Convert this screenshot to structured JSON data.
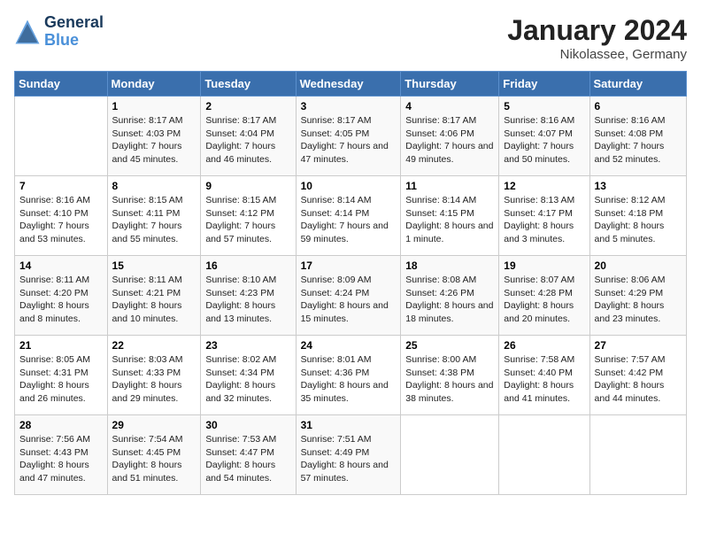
{
  "header": {
    "logo_line1": "General",
    "logo_line2": "Blue",
    "month_title": "January 2024",
    "location": "Nikolassee, Germany"
  },
  "weekdays": [
    "Sunday",
    "Monday",
    "Tuesday",
    "Wednesday",
    "Thursday",
    "Friday",
    "Saturday"
  ],
  "weeks": [
    [
      {
        "day": "",
        "sunrise": "",
        "sunset": "",
        "daylight": ""
      },
      {
        "day": "1",
        "sunrise": "Sunrise: 8:17 AM",
        "sunset": "Sunset: 4:03 PM",
        "daylight": "Daylight: 7 hours and 45 minutes."
      },
      {
        "day": "2",
        "sunrise": "Sunrise: 8:17 AM",
        "sunset": "Sunset: 4:04 PM",
        "daylight": "Daylight: 7 hours and 46 minutes."
      },
      {
        "day": "3",
        "sunrise": "Sunrise: 8:17 AM",
        "sunset": "Sunset: 4:05 PM",
        "daylight": "Daylight: 7 hours and 47 minutes."
      },
      {
        "day": "4",
        "sunrise": "Sunrise: 8:17 AM",
        "sunset": "Sunset: 4:06 PM",
        "daylight": "Daylight: 7 hours and 49 minutes."
      },
      {
        "day": "5",
        "sunrise": "Sunrise: 8:16 AM",
        "sunset": "Sunset: 4:07 PM",
        "daylight": "Daylight: 7 hours and 50 minutes."
      },
      {
        "day": "6",
        "sunrise": "Sunrise: 8:16 AM",
        "sunset": "Sunset: 4:08 PM",
        "daylight": "Daylight: 7 hours and 52 minutes."
      }
    ],
    [
      {
        "day": "7",
        "sunrise": "Sunrise: 8:16 AM",
        "sunset": "Sunset: 4:10 PM",
        "daylight": "Daylight: 7 hours and 53 minutes."
      },
      {
        "day": "8",
        "sunrise": "Sunrise: 8:15 AM",
        "sunset": "Sunset: 4:11 PM",
        "daylight": "Daylight: 7 hours and 55 minutes."
      },
      {
        "day": "9",
        "sunrise": "Sunrise: 8:15 AM",
        "sunset": "Sunset: 4:12 PM",
        "daylight": "Daylight: 7 hours and 57 minutes."
      },
      {
        "day": "10",
        "sunrise": "Sunrise: 8:14 AM",
        "sunset": "Sunset: 4:14 PM",
        "daylight": "Daylight: 7 hours and 59 minutes."
      },
      {
        "day": "11",
        "sunrise": "Sunrise: 8:14 AM",
        "sunset": "Sunset: 4:15 PM",
        "daylight": "Daylight: 8 hours and 1 minute."
      },
      {
        "day": "12",
        "sunrise": "Sunrise: 8:13 AM",
        "sunset": "Sunset: 4:17 PM",
        "daylight": "Daylight: 8 hours and 3 minutes."
      },
      {
        "day": "13",
        "sunrise": "Sunrise: 8:12 AM",
        "sunset": "Sunset: 4:18 PM",
        "daylight": "Daylight: 8 hours and 5 minutes."
      }
    ],
    [
      {
        "day": "14",
        "sunrise": "Sunrise: 8:11 AM",
        "sunset": "Sunset: 4:20 PM",
        "daylight": "Daylight: 8 hours and 8 minutes."
      },
      {
        "day": "15",
        "sunrise": "Sunrise: 8:11 AM",
        "sunset": "Sunset: 4:21 PM",
        "daylight": "Daylight: 8 hours and 10 minutes."
      },
      {
        "day": "16",
        "sunrise": "Sunrise: 8:10 AM",
        "sunset": "Sunset: 4:23 PM",
        "daylight": "Daylight: 8 hours and 13 minutes."
      },
      {
        "day": "17",
        "sunrise": "Sunrise: 8:09 AM",
        "sunset": "Sunset: 4:24 PM",
        "daylight": "Daylight: 8 hours and 15 minutes."
      },
      {
        "day": "18",
        "sunrise": "Sunrise: 8:08 AM",
        "sunset": "Sunset: 4:26 PM",
        "daylight": "Daylight: 8 hours and 18 minutes."
      },
      {
        "day": "19",
        "sunrise": "Sunrise: 8:07 AM",
        "sunset": "Sunset: 4:28 PM",
        "daylight": "Daylight: 8 hours and 20 minutes."
      },
      {
        "day": "20",
        "sunrise": "Sunrise: 8:06 AM",
        "sunset": "Sunset: 4:29 PM",
        "daylight": "Daylight: 8 hours and 23 minutes."
      }
    ],
    [
      {
        "day": "21",
        "sunrise": "Sunrise: 8:05 AM",
        "sunset": "Sunset: 4:31 PM",
        "daylight": "Daylight: 8 hours and 26 minutes."
      },
      {
        "day": "22",
        "sunrise": "Sunrise: 8:03 AM",
        "sunset": "Sunset: 4:33 PM",
        "daylight": "Daylight: 8 hours and 29 minutes."
      },
      {
        "day": "23",
        "sunrise": "Sunrise: 8:02 AM",
        "sunset": "Sunset: 4:34 PM",
        "daylight": "Daylight: 8 hours and 32 minutes."
      },
      {
        "day": "24",
        "sunrise": "Sunrise: 8:01 AM",
        "sunset": "Sunset: 4:36 PM",
        "daylight": "Daylight: 8 hours and 35 minutes."
      },
      {
        "day": "25",
        "sunrise": "Sunrise: 8:00 AM",
        "sunset": "Sunset: 4:38 PM",
        "daylight": "Daylight: 8 hours and 38 minutes."
      },
      {
        "day": "26",
        "sunrise": "Sunrise: 7:58 AM",
        "sunset": "Sunset: 4:40 PM",
        "daylight": "Daylight: 8 hours and 41 minutes."
      },
      {
        "day": "27",
        "sunrise": "Sunrise: 7:57 AM",
        "sunset": "Sunset: 4:42 PM",
        "daylight": "Daylight: 8 hours and 44 minutes."
      }
    ],
    [
      {
        "day": "28",
        "sunrise": "Sunrise: 7:56 AM",
        "sunset": "Sunset: 4:43 PM",
        "daylight": "Daylight: 8 hours and 47 minutes."
      },
      {
        "day": "29",
        "sunrise": "Sunrise: 7:54 AM",
        "sunset": "Sunset: 4:45 PM",
        "daylight": "Daylight: 8 hours and 51 minutes."
      },
      {
        "day": "30",
        "sunrise": "Sunrise: 7:53 AM",
        "sunset": "Sunset: 4:47 PM",
        "daylight": "Daylight: 8 hours and 54 minutes."
      },
      {
        "day": "31",
        "sunrise": "Sunrise: 7:51 AM",
        "sunset": "Sunset: 4:49 PM",
        "daylight": "Daylight: 8 hours and 57 minutes."
      },
      {
        "day": "",
        "sunrise": "",
        "sunset": "",
        "daylight": ""
      },
      {
        "day": "",
        "sunrise": "",
        "sunset": "",
        "daylight": ""
      },
      {
        "day": "",
        "sunrise": "",
        "sunset": "",
        "daylight": ""
      }
    ]
  ]
}
